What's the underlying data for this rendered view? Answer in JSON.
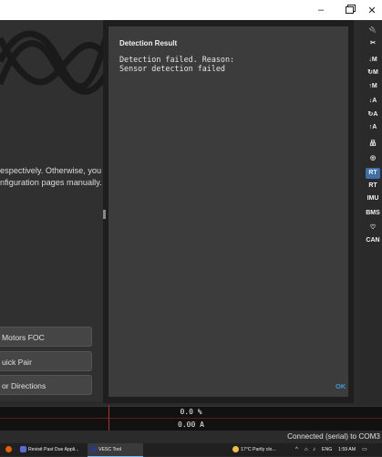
{
  "window": {
    "minimize_glyph": "–",
    "close_glyph": "✕"
  },
  "left": {
    "description_line1": "espectively. Otherwise, you",
    "description_line2": "nfiguration pages manually.",
    "buttons": [
      "Motors FOC",
      "uick Pair",
      "or Directions"
    ]
  },
  "dialog": {
    "title": "Detection Result",
    "message": "Detection failed. Reason:\nSensor detection failed",
    "ok_label": "OK"
  },
  "toolbar": {
    "icons": [
      {
        "name": "connect-plug-icon",
        "glyph": "🔌"
      },
      {
        "name": "disconnect-plug-icon",
        "glyph": "✂"
      },
      {
        "name": "read-motor-config-icon",
        "glyph": "↓M"
      },
      {
        "name": "read-default-motor-config-icon",
        "glyph": "↻M"
      },
      {
        "name": "write-motor-config-icon",
        "glyph": "↑M"
      },
      {
        "name": "read-app-config-icon",
        "glyph": "↓A"
      },
      {
        "name": "read-default-app-config-icon",
        "glyph": "↻A"
      },
      {
        "name": "write-app-config-icon",
        "glyph": "↑A"
      },
      {
        "name": "canbus-nodes-icon",
        "glyph": "品"
      },
      {
        "name": "gamepad-icon",
        "glyph": "◎"
      },
      {
        "name": "rt-data-icon",
        "glyph": "RT"
      },
      {
        "name": "rt-app-icon",
        "glyph": "RT"
      },
      {
        "name": "imu-icon",
        "glyph": "IMU"
      },
      {
        "name": "bms-icon",
        "glyph": "BMS"
      },
      {
        "name": "heart-icon",
        "glyph": "♡"
      },
      {
        "name": "can-icon",
        "glyph": "CAN"
      }
    ]
  },
  "status": {
    "duty": "0.0 %",
    "current": "0.00 A",
    "connection": "Connected (serial) to COM3"
  },
  "taskbar": {
    "items": [
      {
        "label": "Revisit Past Due Appli..."
      },
      {
        "label": "VESC Tool"
      }
    ],
    "weather": "17°C  Partly clo...",
    "language": "ENG",
    "time": "1:59 AM"
  },
  "colors": {
    "accent": "#3f9ad6",
    "dialog_bg": "#3c3c3c",
    "app_bg": "#2b2b2b"
  }
}
